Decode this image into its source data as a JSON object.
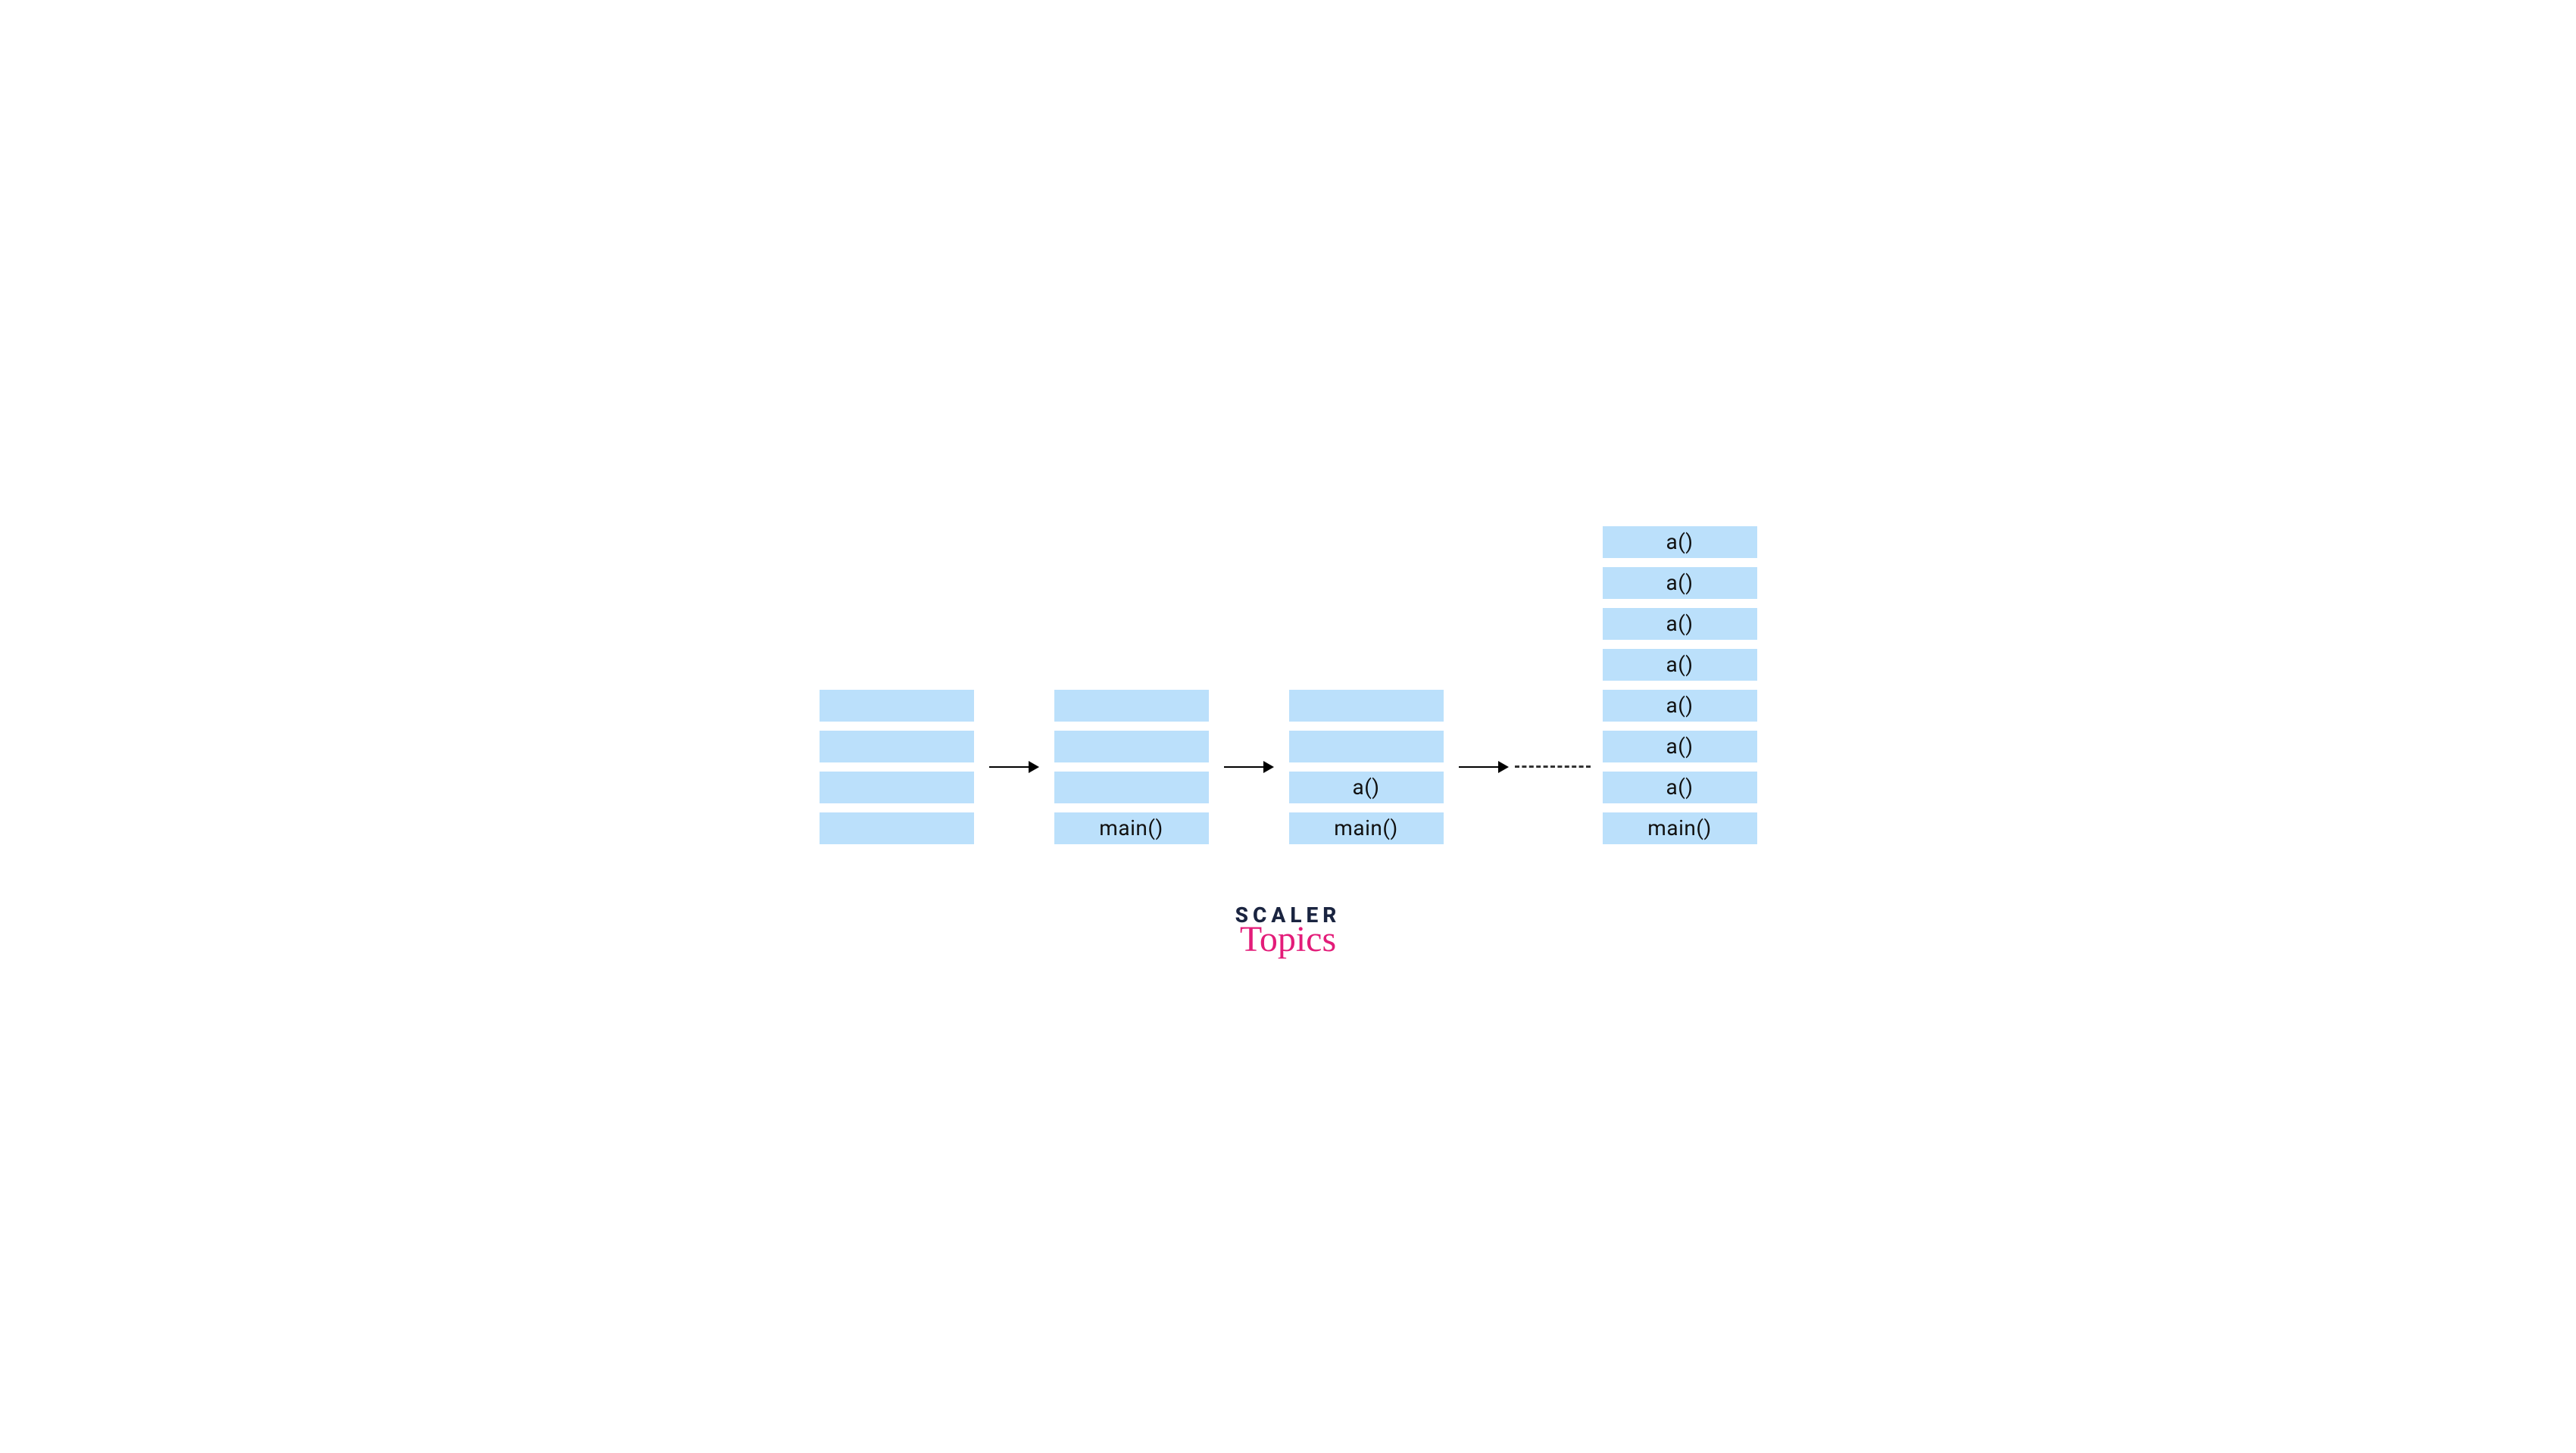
{
  "stacks": [
    {
      "frames": [
        "",
        "",
        "",
        ""
      ]
    },
    {
      "frames": [
        "",
        "",
        "",
        "main()"
      ]
    },
    {
      "frames": [
        "",
        "",
        "a()",
        "main()"
      ]
    },
    {
      "frames": [
        "a()",
        "a()",
        "a()",
        "a()",
        "a()",
        "a()",
        "a()",
        "main()"
      ]
    }
  ],
  "logo": {
    "line1": "SCALER",
    "line2": "Topics"
  },
  "colors": {
    "frame_bg": "#bbe0fb",
    "text": "#111111",
    "logo_dark": "#1a2440",
    "logo_pink": "#e31c79"
  }
}
